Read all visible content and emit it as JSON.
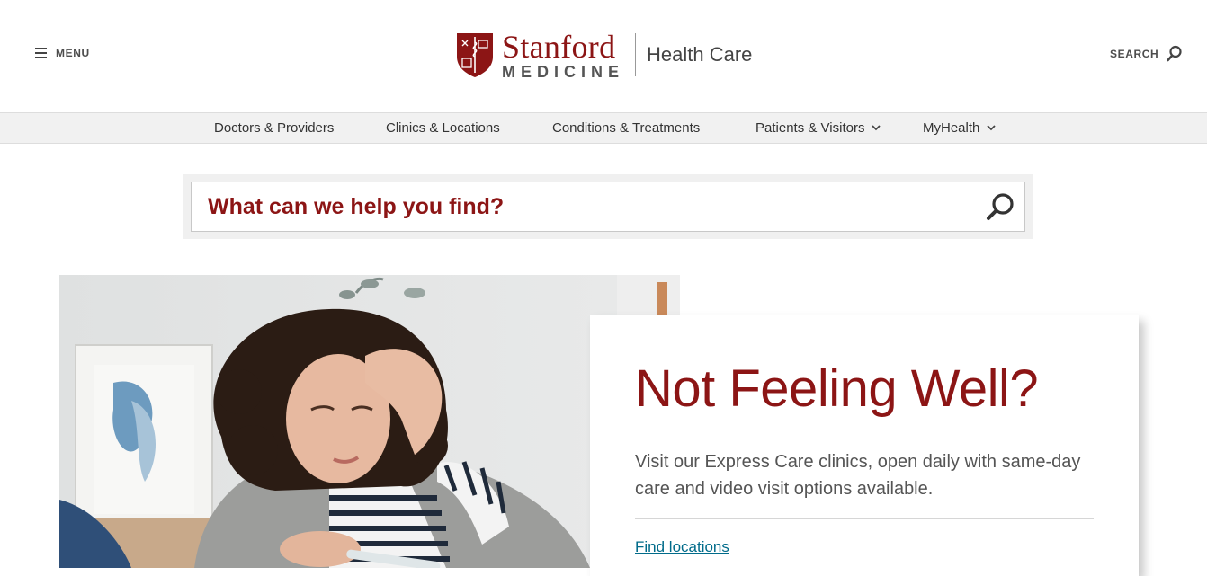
{
  "header": {
    "menu_label": "MENU",
    "search_label": "SEARCH",
    "logo": {
      "stanford": "Stanford",
      "medicine": "MEDICINE",
      "health_care": "Health Care"
    }
  },
  "nav": {
    "items": [
      {
        "label": "Doctors & Providers",
        "has_dropdown": false
      },
      {
        "label": "Clinics & Locations",
        "has_dropdown": false
      },
      {
        "label": "Conditions & Treatments",
        "has_dropdown": false
      },
      {
        "label": "Patients & Visitors",
        "has_dropdown": true
      },
      {
        "label": "MyHealth",
        "has_dropdown": true
      }
    ]
  },
  "search": {
    "placeholder": "What can we help you find?",
    "value": ""
  },
  "hero": {
    "image": "woman-with-fever-photo"
  },
  "card": {
    "title": "Not Feeling Well?",
    "body": "Visit our Express Care clinics, open daily with same-day care and video visit options available.",
    "link_label": "Find locations"
  },
  "colors": {
    "brand_red": "#8c1515",
    "nav_bg": "#f1f1f1",
    "link": "#006b8a"
  }
}
